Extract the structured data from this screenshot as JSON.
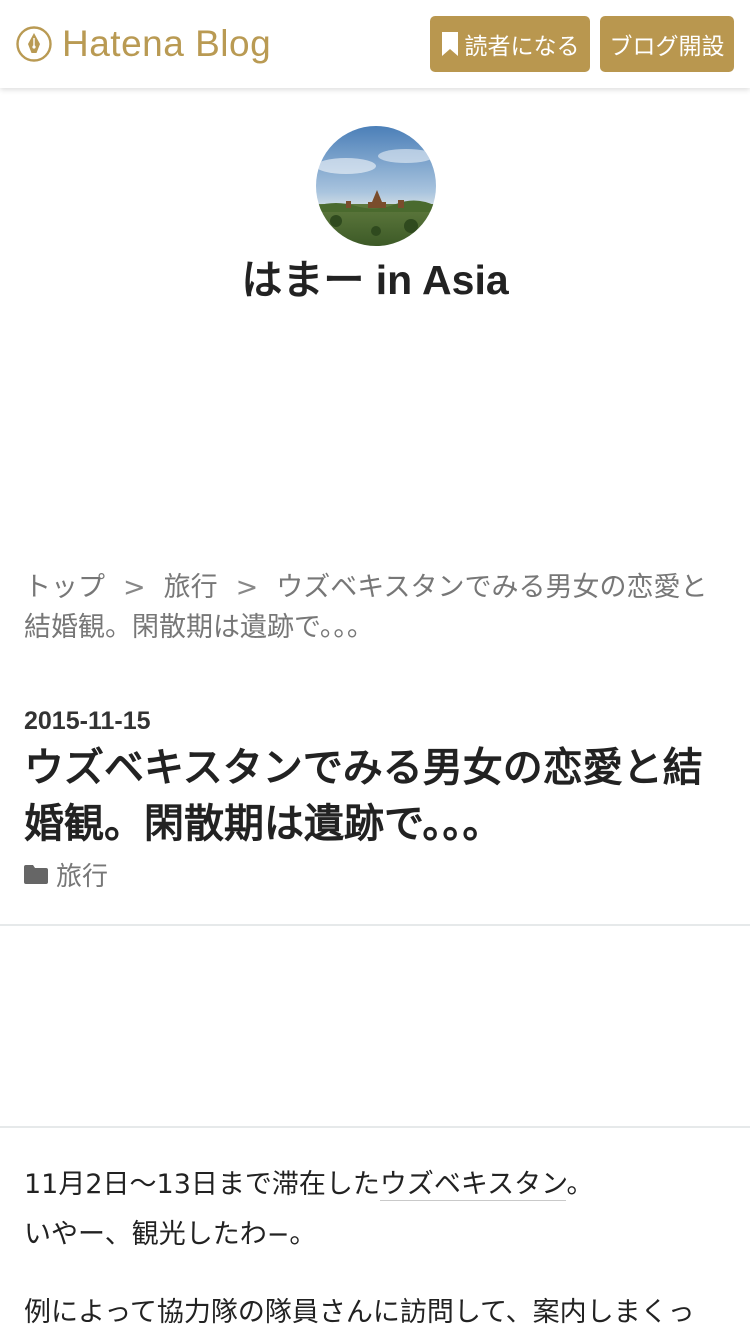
{
  "header": {
    "logo_text": "Hatena Blog",
    "subscribe_label": "読者になる",
    "open_blog_label": "ブログ開設",
    "brand_color": "#b9974f"
  },
  "blog": {
    "title": "はまー in Asia"
  },
  "breadcrumb": {
    "items": [
      "トップ",
      "旅行",
      "ウズベキスタンでみる男女の恋愛と結婚観。閑散期は遺跡で。。。"
    ],
    "separator": ">"
  },
  "entry": {
    "date": "2015-11-15",
    "title": "ウズベキスタンでみる男女の恋愛と結婚観。閑散期は遺跡で。。。",
    "category": "旅行",
    "body": {
      "p1_before": "11月2日〜13日まで滞在した",
      "p1_link": "ウズベキスタン",
      "p1_after": "。",
      "p2": "いやー、観光したわ−。",
      "p3": "例によって協力隊の隊員さんに訪問して、案内しまくっ"
    }
  }
}
